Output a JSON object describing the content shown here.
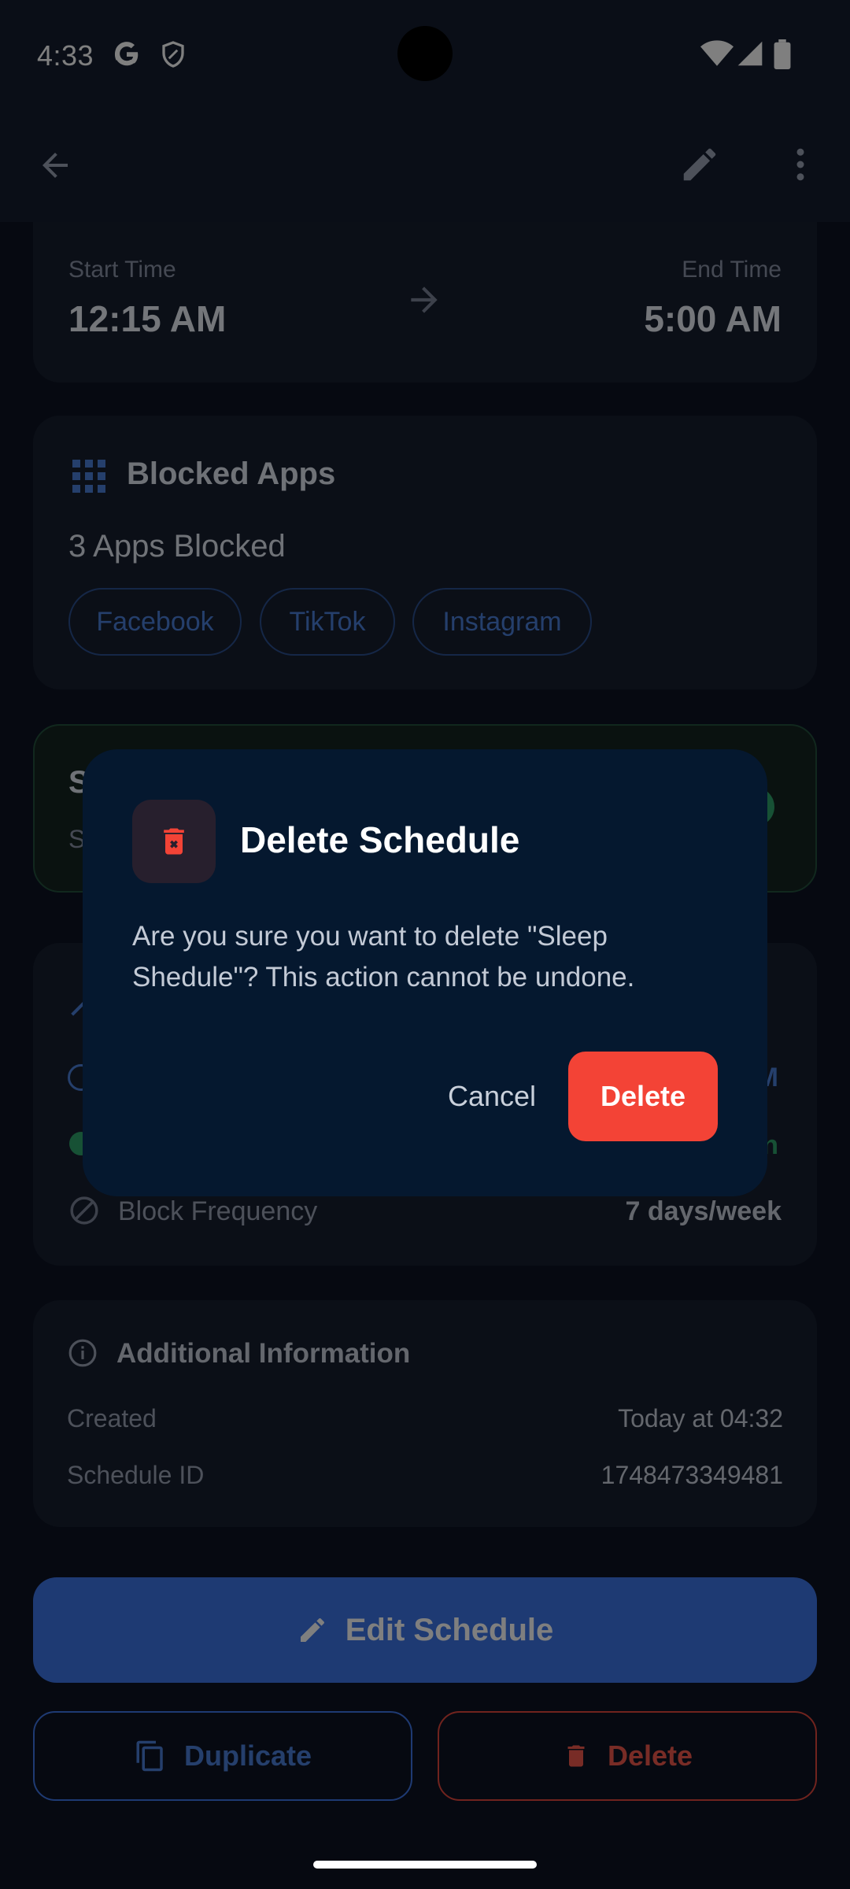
{
  "status_bar": {
    "time": "4:33"
  },
  "schedule_times": {
    "start_label": "Start Time",
    "start_value": "12:15 AM",
    "end_label": "End Time",
    "end_value": "5:00 AM"
  },
  "blocked_apps": {
    "title": "Blocked Apps",
    "count_text": "3 Apps Blocked",
    "apps": [
      "Facebook",
      "TikTok",
      "Instagram"
    ]
  },
  "status_card": {
    "title_partial": "S",
    "subtitle_partial": "S"
  },
  "details": {
    "row_time_value_partial": "M",
    "row_status_value_partial": "n",
    "block_frequency_label": "Block Frequency",
    "block_frequency_value": "7 days/week"
  },
  "additional_info": {
    "title": "Additional Information",
    "created_label": "Created",
    "created_value": "Today at 04:32",
    "id_label": "Schedule ID",
    "id_value": "1748473349481"
  },
  "actions": {
    "edit_label": "Edit Schedule",
    "duplicate_label": "Duplicate",
    "delete_label": "Delete"
  },
  "dialog": {
    "title": "Delete Schedule",
    "message": "Are you sure you want to delete \"Sleep Shedule\"? This action cannot be undone.",
    "cancel_label": "Cancel",
    "confirm_label": "Delete"
  },
  "colors": {
    "primary": "#3d74e6",
    "danger": "#f34336",
    "success": "#2fa36b",
    "background": "#0d1322",
    "dialog_background": "#05182f"
  }
}
